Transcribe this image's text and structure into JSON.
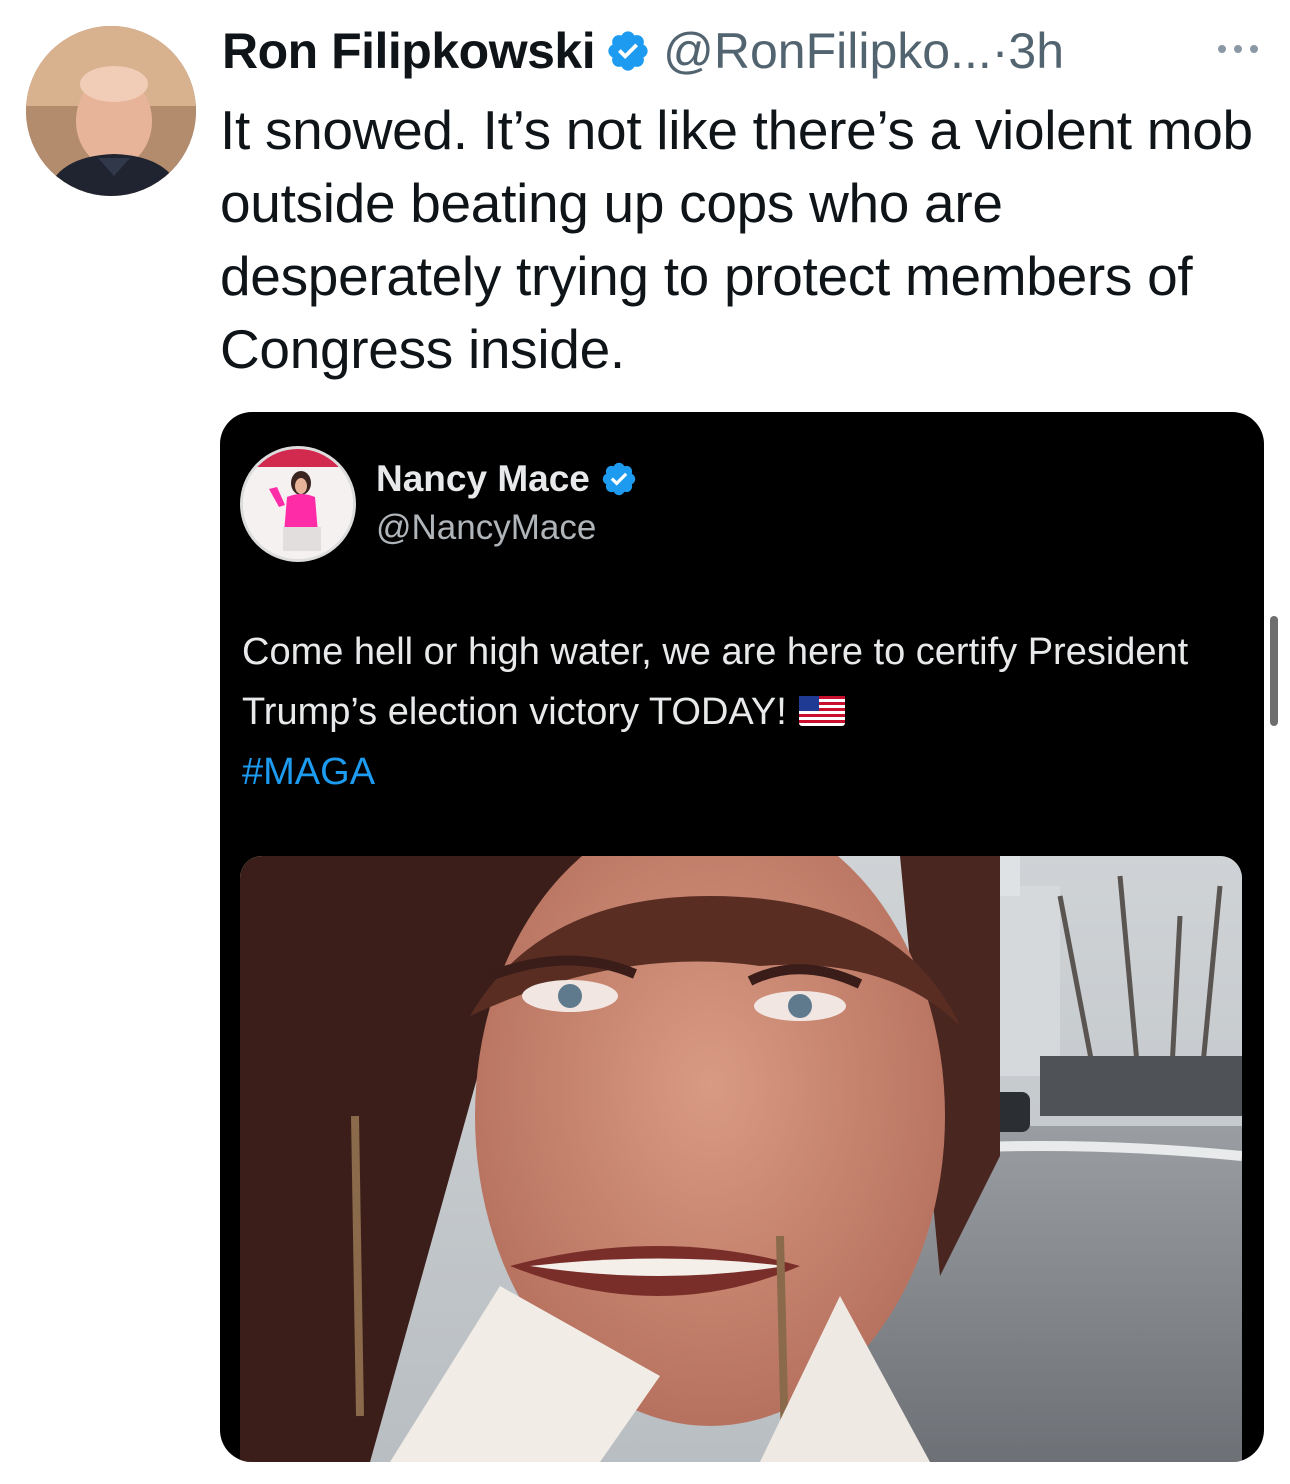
{
  "tweet": {
    "author_name": "Ron Filipkowski",
    "handle": "@RonFilipko...",
    "separator": "·",
    "time": "3h",
    "text": "It snowed. It’s not like there’s a violent mob outside beating up cops who are desperately trying to protect members of Congress inside.",
    "avatar_icon": "profile-photo",
    "verified_icon": "verified-badge-icon",
    "more_icon": "more-options-icon"
  },
  "quoted": {
    "author_name": "Nancy Mace",
    "handle": "@NancyMace",
    "text": "Come hell or high water, we are here to certify President Trump’s election victory TODAY!",
    "flag_icon": "us-flag-emoji",
    "hashtag": "#MAGA",
    "media": "video-selfie-snowy-capitol"
  },
  "colors": {
    "text_primary": "#0f1419",
    "text_secondary": "#536471",
    "verified_blue": "#1d9bf0",
    "card_background": "#000000",
    "hashtag": "#1d9bf0"
  }
}
